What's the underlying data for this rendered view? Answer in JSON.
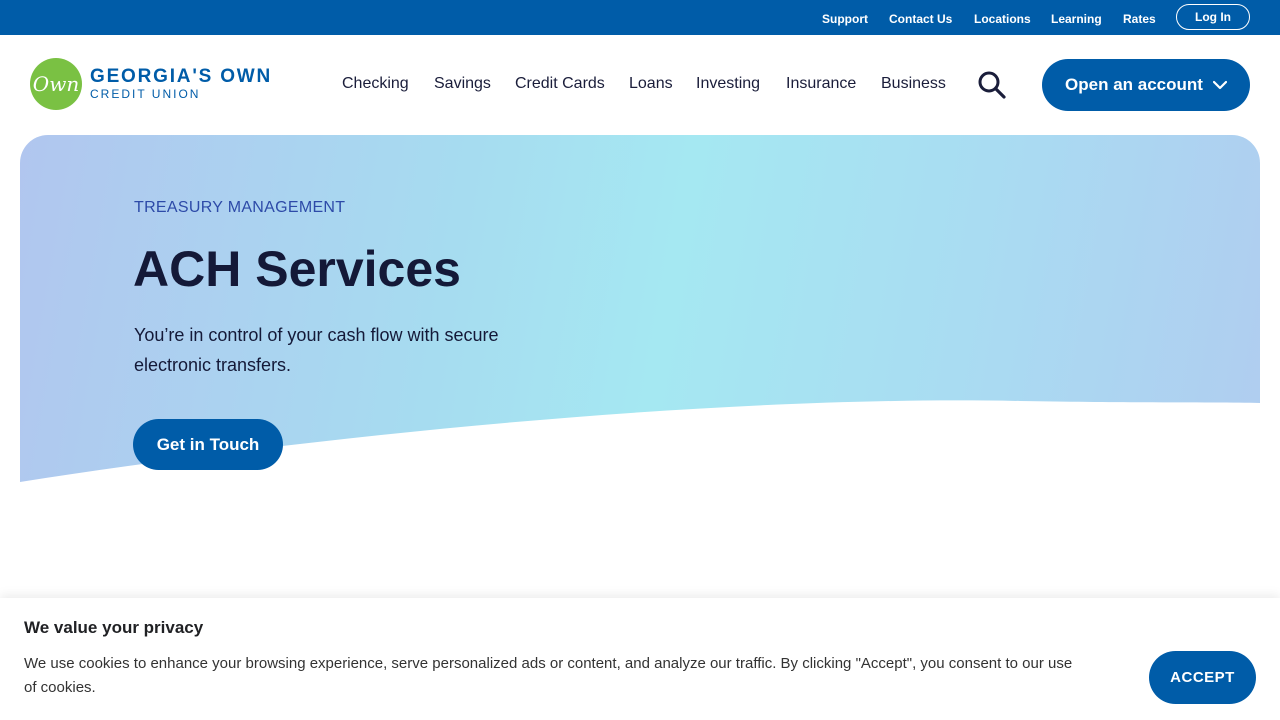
{
  "utility_nav": {
    "links": [
      "Support",
      "Contact Us",
      "Locations",
      "Learning",
      "Rates"
    ],
    "login_label": "Log In"
  },
  "logo": {
    "mark_text": "Own",
    "line1": "GEORGIA'S OWN",
    "line2": "CREDIT UNION"
  },
  "main_nav": {
    "items": [
      "Checking",
      "Savings",
      "Credit Cards",
      "Loans",
      "Investing",
      "Insurance",
      "Business"
    ],
    "search_icon": "search-icon",
    "open_account_label": "Open an account"
  },
  "hero": {
    "eyebrow": "TREASURY MANAGEMENT",
    "title": "ACH Services",
    "description": "You’re in control of your cash flow with secure electronic transfers.",
    "cta_label": "Get in Touch"
  },
  "cookie_banner": {
    "title": "We value your privacy",
    "text": "We use cookies to enhance your browsing experience, serve personalized ads or content, and analyze our traffic. By clicking \"Accept\", you consent to our use of cookies.",
    "accept_label": "ACCEPT"
  },
  "colors": {
    "brand_blue": "#005ca8",
    "logo_green": "#7ac143",
    "eyebrow_blue": "#2d4aa8",
    "dark_text": "#141938"
  }
}
